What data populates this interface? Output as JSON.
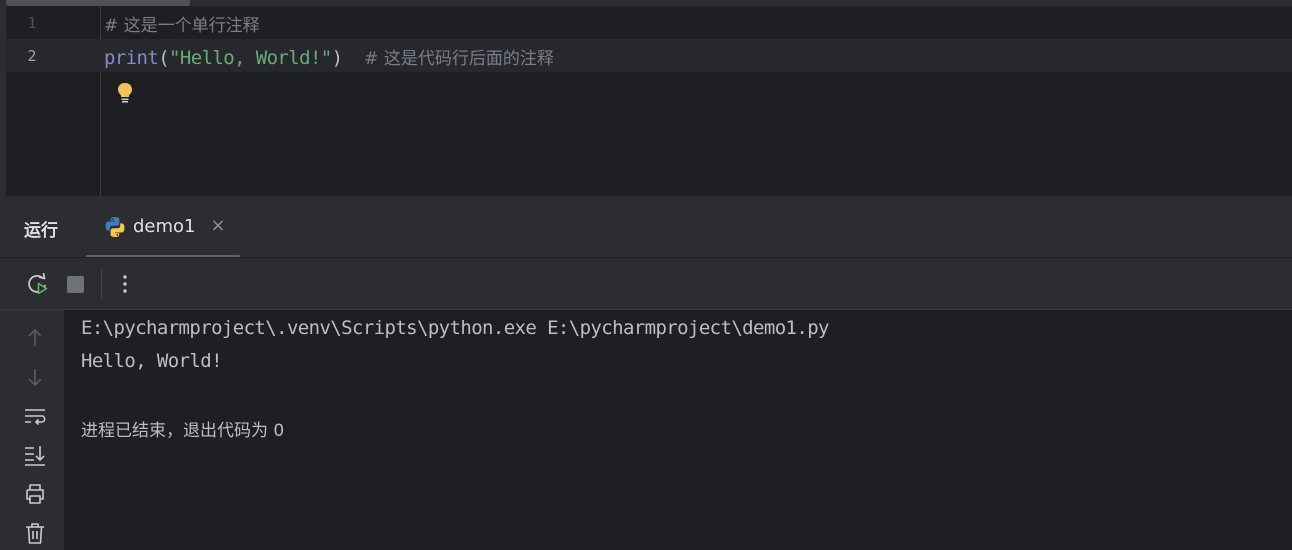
{
  "editor": {
    "lines": [
      {
        "number": "1",
        "comment": "# 这是一个单行注释"
      },
      {
        "number": "2",
        "func": "print",
        "open_paren": "(",
        "string": "\"Hello, World!\"",
        "close_paren": ")",
        "comment": "# 这是代码行后面的注释"
      }
    ]
  },
  "run_panel": {
    "title": "运行",
    "tab": {
      "label": "demo1",
      "close": "×"
    },
    "console": {
      "command": "E:\\pycharmproject\\.venv\\Scripts\\python.exe E:\\pycharmproject\\demo1.py",
      "output": "Hello, World!",
      "exit_message": "进程已结束，退出代码为 0"
    }
  },
  "icons": {
    "toolbar": [
      "rerun-icon",
      "stop-icon",
      "more-options-icon"
    ],
    "side": [
      "scroll-up-icon",
      "scroll-down-icon",
      "soft-wrap-icon",
      "scroll-to-end-icon",
      "print-icon",
      "clear-trash-icon"
    ],
    "editor": [
      "intention-bulb-icon"
    ]
  },
  "colors": {
    "background": "#1e1f22",
    "panel": "#2b2d30",
    "comment": "#7a7e85",
    "builtin": "#8888c6",
    "string": "#6aab73",
    "bulb": "#f2c55c"
  }
}
